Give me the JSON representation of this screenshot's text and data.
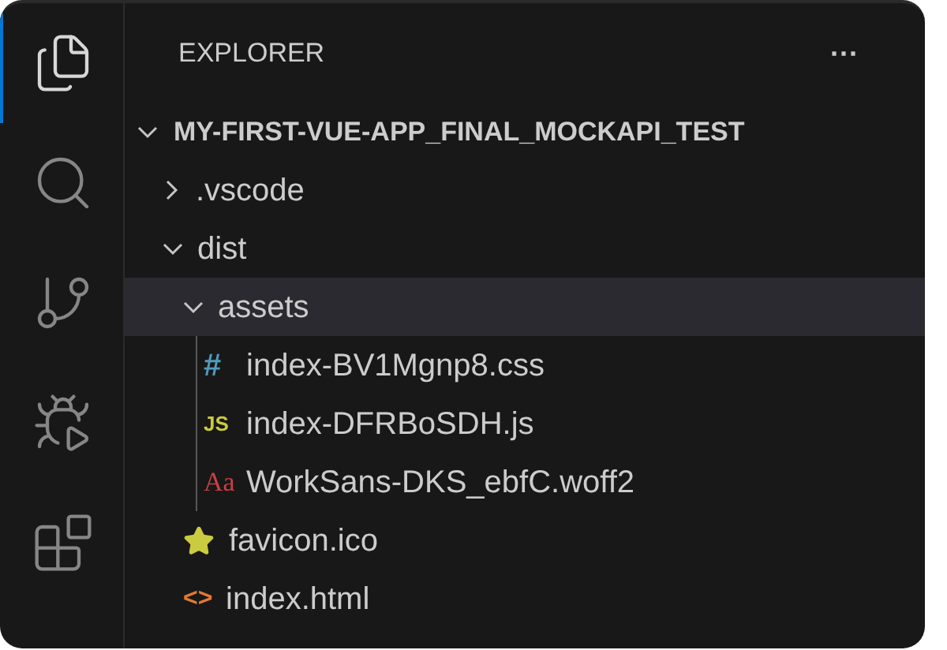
{
  "activity_bar": [
    {
      "kind": "files",
      "selected": true
    },
    {
      "kind": "search",
      "selected": false
    },
    {
      "kind": "source-control",
      "selected": false
    },
    {
      "kind": "run-debug",
      "selected": false
    },
    {
      "kind": "extensions",
      "selected": false
    }
  ],
  "sidebar": {
    "title": "EXPLORER",
    "more": "···",
    "root": {
      "label": "MY-FIRST-VUE-APP_FINAL_MOCKAPI_TEST",
      "expanded": true
    },
    "items": [
      {
        "kind": "folder",
        "label": ".vscode",
        "expanded": false,
        "selected": false
      },
      {
        "kind": "folder",
        "label": "dist",
        "expanded": true,
        "selected": false,
        "children": [
          {
            "kind": "folder",
            "label": "assets",
            "expanded": true,
            "selected": true,
            "children": [
              {
                "kind": "css",
                "icon": "#",
                "label": "index-BV1Mgnp8.css",
                "selected": false
              },
              {
                "kind": "js",
                "icon": "JS",
                "label": "index-DFRBoSDH.js",
                "selected": false
              },
              {
                "kind": "font",
                "icon": "Aa",
                "label": "WorkSans-DKS_ebfC.woff2",
                "selected": false
              }
            ]
          },
          {
            "kind": "favicon",
            "label": "favicon.ico",
            "selected": false
          },
          {
            "kind": "html",
            "icon": "<>",
            "label": "index.html",
            "selected": false
          }
        ]
      }
    ]
  }
}
